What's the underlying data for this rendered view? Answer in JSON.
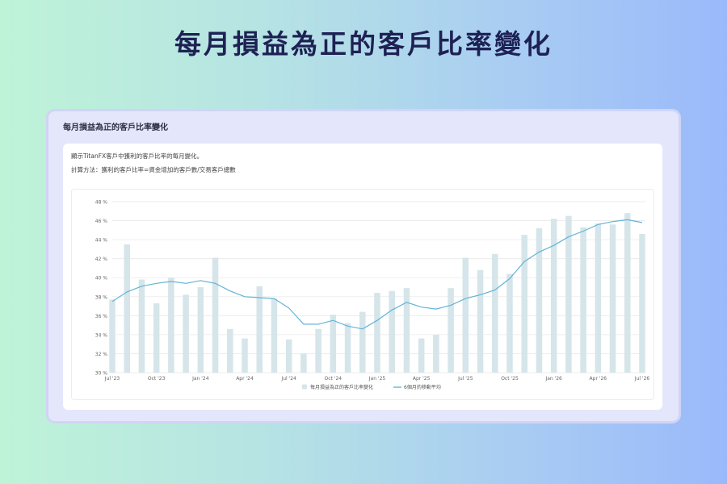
{
  "page": {
    "title": "每月損益為正的客戶比率變化"
  },
  "card": {
    "header": "每月損益為正的客戶比率變化",
    "description_line1": "顯示TitanFX客戶中獲利的客戶比率的每月變化。",
    "description_line2": "計算方法：獲利的客戶比率=資金增加的客戶數/交易客戶總數"
  },
  "chart_data": {
    "type": "bar",
    "x": [
      "2023-07",
      "2023-08",
      "2023-09",
      "2023-10",
      "2023-11",
      "2023-12",
      "2024-01",
      "2024-02",
      "2024-03",
      "2024-04",
      "2024-05",
      "2024-06",
      "2024-07",
      "2024-08",
      "2024-09",
      "2024-10",
      "2024-11",
      "2024-12",
      "2025-01",
      "2025-02",
      "2025-03",
      "2025-04",
      "2025-05",
      "2025-06",
      "2025-07",
      "2025-08",
      "2025-09",
      "2025-10",
      "2025-11",
      "2025-12",
      "2026-01",
      "2026-02",
      "2026-03",
      "2026-04",
      "2026-05",
      "2026-06",
      "2026-07"
    ],
    "x_tick_labels": [
      {
        "x": "2023-07",
        "label": "Jul '23"
      },
      {
        "x": "2023-10",
        "label": "Oct '23"
      },
      {
        "x": "2024-01",
        "label": "Jan '24"
      },
      {
        "x": "2024-04",
        "label": "Apr '24"
      },
      {
        "x": "2024-07",
        "label": "Jul '24"
      },
      {
        "x": "2024-10",
        "label": "Oct '24"
      },
      {
        "x": "2025-01",
        "label": "Jan '25"
      },
      {
        "x": "2025-04",
        "label": "Apr '25"
      },
      {
        "x": "2025-07",
        "label": "Jul '25"
      },
      {
        "x": "2025-10",
        "label": "Oct '25"
      },
      {
        "x": "2026-01",
        "label": "Jan '26"
      },
      {
        "x": "2026-04",
        "label": "Apr '26"
      },
      {
        "x": "2026-07",
        "label": "Jul '26"
      }
    ],
    "y_ticks": [
      30,
      32,
      34,
      36,
      38,
      40,
      42,
      44,
      46,
      48
    ],
    "y_tick_labels": [
      "30 %",
      "32 %",
      "34 %",
      "36 %",
      "38 %",
      "40 %",
      "42 %",
      "44 %",
      "46 %",
      "48 %"
    ],
    "ylim": [
      30,
      48
    ],
    "grid": true,
    "legend_position": "bottom-center",
    "series": [
      {
        "name": "每月損益為正的客戶比率變化",
        "type": "bar",
        "color": "#d5e5ea",
        "values": [
          37.7,
          43.5,
          39.8,
          37.3,
          40.0,
          38.2,
          39.0,
          42.1,
          34.6,
          33.6,
          39.1,
          37.8,
          33.5,
          32.0,
          34.6,
          36.1,
          35.2,
          36.4,
          38.4,
          38.6,
          38.9,
          33.6,
          34.0,
          38.9,
          42.1,
          40.8,
          42.5,
          40.4,
          44.5,
          45.2,
          46.2,
          46.5,
          45.3,
          45.7,
          45.6,
          46.8,
          44.6
        ]
      },
      {
        "name": "6個月的移動平均",
        "type": "line",
        "color": "#63b3d6",
        "values": [
          37.5,
          38.5,
          39.1,
          39.4,
          39.6,
          39.4,
          39.7,
          39.4,
          38.6,
          38.0,
          37.9,
          37.8,
          36.8,
          35.1,
          35.1,
          35.5,
          34.9,
          34.6,
          35.5,
          36.6,
          37.4,
          36.9,
          36.7,
          37.1,
          37.8,
          38.2,
          38.7,
          39.9,
          41.7,
          42.7,
          43.4,
          44.3,
          44.9,
          45.6,
          45.9,
          46.1,
          45.8
        ]
      }
    ]
  }
}
